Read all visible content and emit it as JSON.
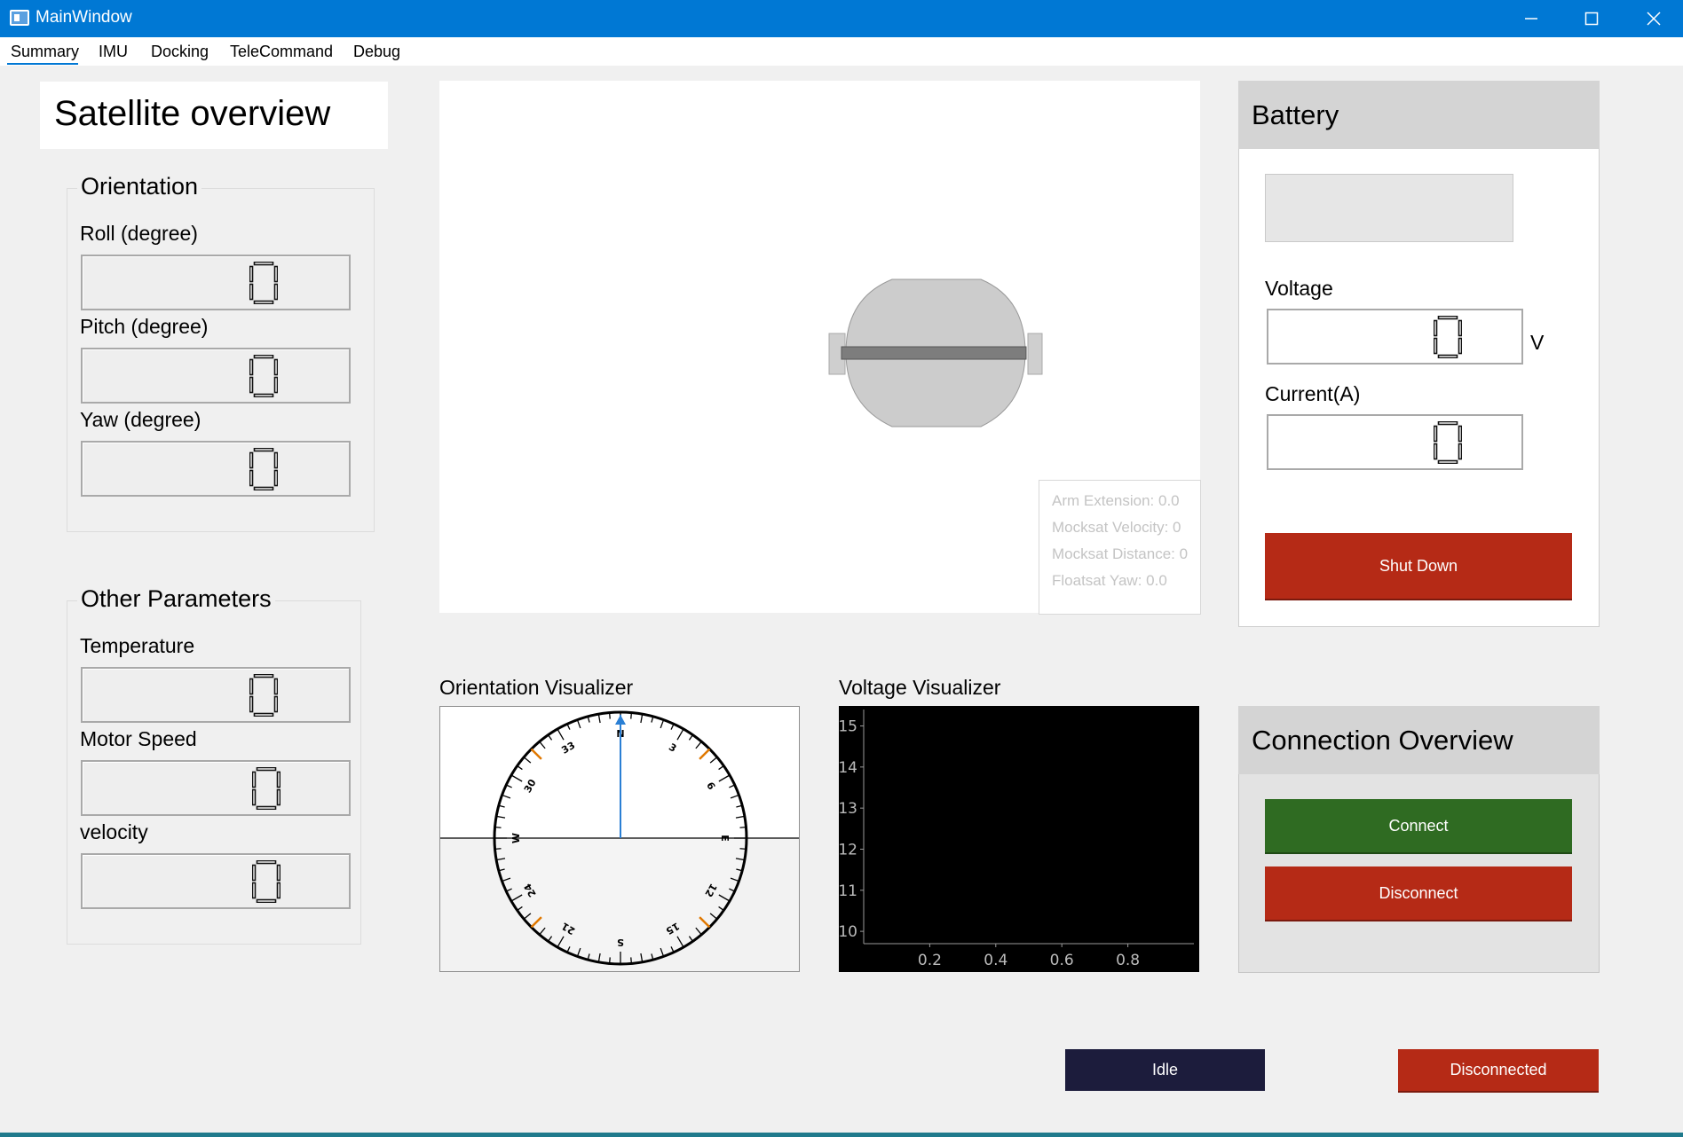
{
  "window": {
    "title": "MainWindow"
  },
  "menu": [
    "Summary",
    "IMU",
    "Docking",
    "TeleCommand",
    "Debug"
  ],
  "overview_title": "Satellite overview",
  "orientation": {
    "title": "Orientation",
    "roll_label": "Roll (degree)",
    "roll_value": "0",
    "pitch_label": "Pitch (degree)",
    "pitch_value": "0",
    "yaw_label": "Yaw (degree)",
    "yaw_value": "0"
  },
  "other": {
    "title": "Other Parameters",
    "temperature_label": "Temperature",
    "temperature_value": "0",
    "motor_label": "Motor Speed",
    "motor_value": "0",
    "velocity_label": "velocity",
    "velocity_value": "0"
  },
  "scene_info": [
    "Arm Extension: 0.0",
    "Mocksat Velocity: 0",
    "Mocksat Distance: 0",
    "Floatsat Yaw: 0.0"
  ],
  "battery": {
    "title": "Battery",
    "voltage_label": "Voltage",
    "voltage_value": "0",
    "voltage_unit": "V",
    "current_label": "Current(A)",
    "current_value": "0",
    "shutdown_label": "Shut Down"
  },
  "orientation_visualizer": {
    "title": "Orientation Visualizer",
    "heading": 0,
    "labels": [
      "N",
      "3",
      "6",
      "E",
      "12",
      "15",
      "S",
      "21",
      "24",
      "W",
      "30",
      "33"
    ]
  },
  "voltage_visualizer": {
    "title": "Voltage Visualizer"
  },
  "chart_data": {
    "type": "line",
    "title": "",
    "series": [],
    "xlim": [
      0,
      1
    ],
    "ylim": [
      9.7,
      15.4
    ],
    "xticks": [
      "0.2",
      "0.4",
      "0.6",
      "0.8"
    ],
    "yticks": [
      "10",
      "11",
      "12",
      "13",
      "14",
      "15"
    ],
    "background": "#000000"
  },
  "connection": {
    "title": "Connection Overview",
    "connect_label": "Connect",
    "disconnect_label": "Disconnect"
  },
  "status": {
    "state": "Idle",
    "connection": "Disconnected"
  },
  "colors": {
    "titlebar": "#0078d4",
    "red": "#b52a16",
    "green": "#2f6b22",
    "idle": "#1c1c3c"
  }
}
